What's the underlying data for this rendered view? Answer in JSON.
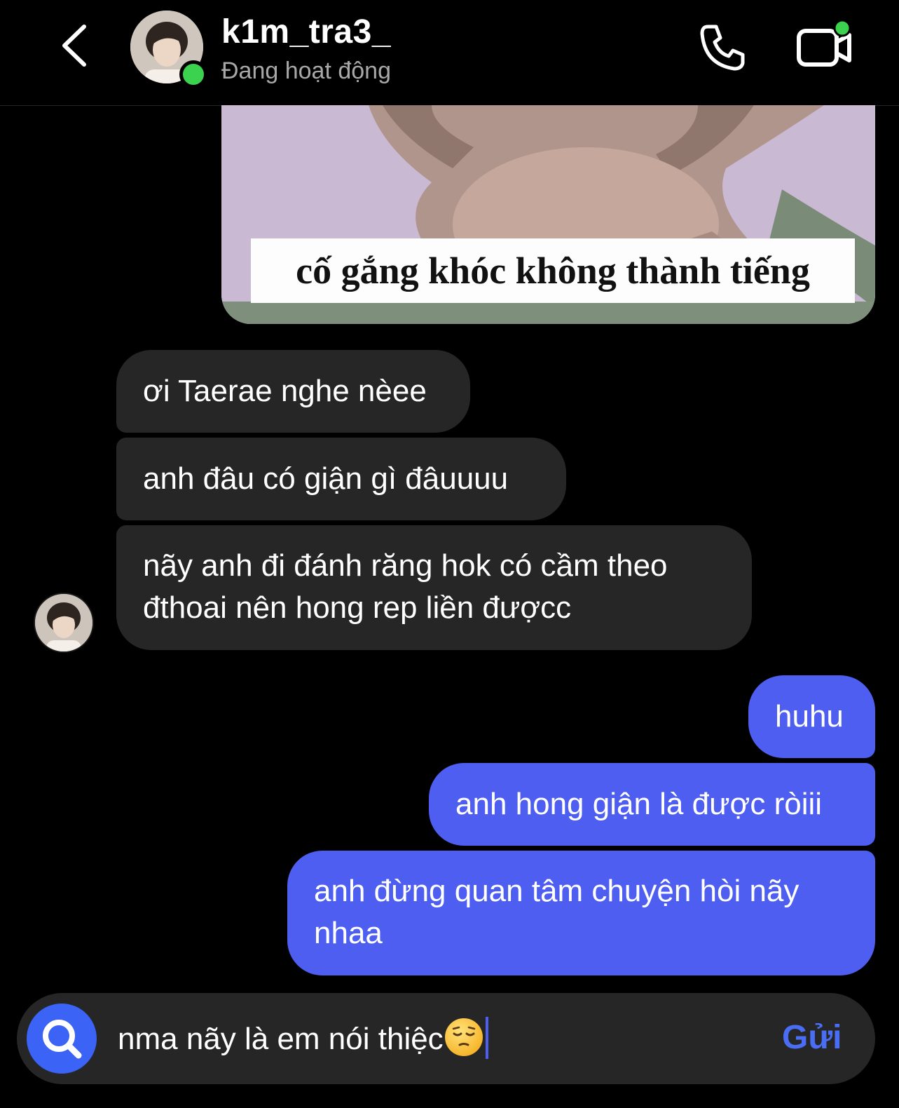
{
  "header": {
    "username": "k1m_tra3_",
    "status": "Đang hoạt động"
  },
  "meme": {
    "caption": "cố gắng khóc không thành tiếng"
  },
  "messages": [
    {
      "side": "in",
      "text": "ơi Taerae nghe nèee"
    },
    {
      "side": "in",
      "text": "anh đâu có giận gì đâuuuu"
    },
    {
      "side": "in",
      "text": "nãy anh đi đánh răng hok có cầm theo\nđthoai nên hong rep liền đượcc"
    },
    {
      "side": "out",
      "text": "huhu"
    },
    {
      "side": "out",
      "text": "anh hong giận là được ròiii"
    },
    {
      "side": "out",
      "text": "anh đừng quan tâm chuyện hòi nãy\nnhaa"
    }
  ],
  "composer": {
    "input_value": "nma nãy là em nói thiệc",
    "emoji": "pensive-face",
    "send_label": "Gửi"
  },
  "colors": {
    "incoming_bubble": "#262626",
    "outgoing_bubble": "#4d5ef0",
    "online_dot": "#3ad24f",
    "send_text": "#4a6df5"
  }
}
